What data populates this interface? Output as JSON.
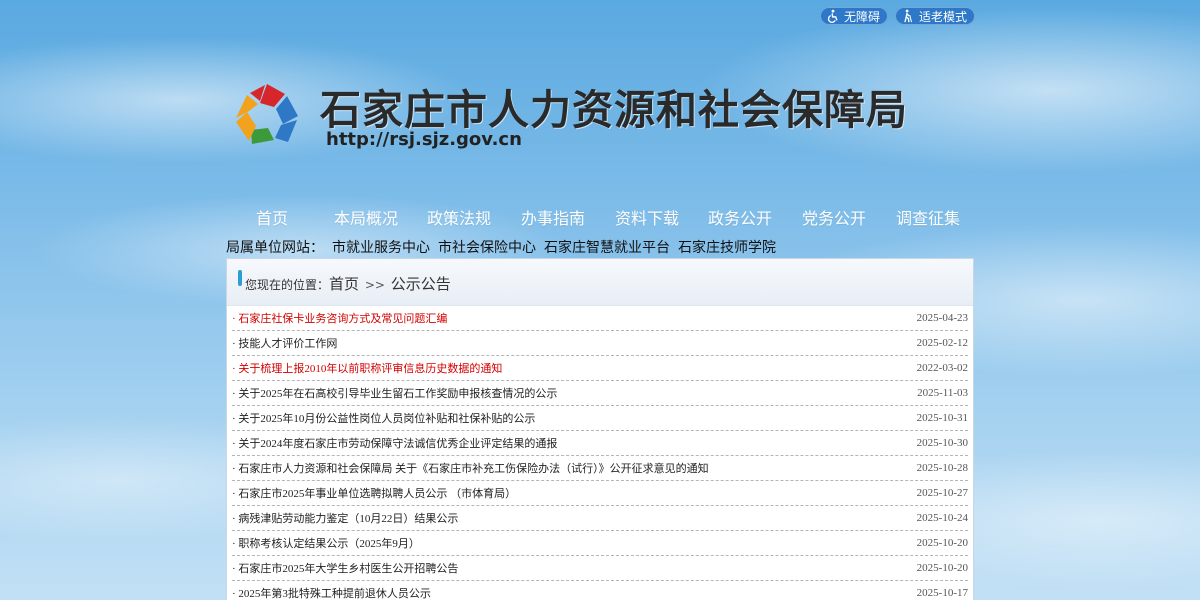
{
  "tools": {
    "accessibility_label": "无障碍",
    "elderly_label": "适老模式"
  },
  "header": {
    "title": "石家庄市人力资源和社会保障局",
    "url": "http://rsj.sjz.gov.cn"
  },
  "nav": {
    "items": [
      "首页",
      "本局概况",
      "政策法规",
      "办事指南",
      "资料下载",
      "政务公开",
      "党务公开",
      "调查征集"
    ]
  },
  "units": {
    "label": "局属单位网站：",
    "links": [
      "市就业服务中心",
      "市社会保险中心",
      "石家庄智慧就业平台",
      "石家庄技师学院"
    ]
  },
  "breadcrumb": {
    "prefix": "您现在的位置：",
    "home": "首页",
    "sep": ">>",
    "current": "公示公告"
  },
  "colors": {
    "hot_item": "#d40000",
    "tool_button": "#2d78c8",
    "head_accent": "#2a9fd6"
  },
  "list": [
    {
      "title": "石家庄社保卡业务咨询方式及常见问题汇编",
      "date": "2025-04-23",
      "hot": true
    },
    {
      "title": "技能人才评价工作网",
      "date": "2025-02-12",
      "hot": false
    },
    {
      "title": "关于梳理上报2010年以前职称评审信息历史数据的通知",
      "date": "2022-03-02",
      "hot": true
    },
    {
      "title": "关于2025年在石高校引导毕业生留石工作奖励申报核查情况的公示",
      "date": "2025-11-03",
      "hot": false
    },
    {
      "title": "关于2025年10月份公益性岗位人员岗位补贴和社保补贴的公示",
      "date": "2025-10-31",
      "hot": false
    },
    {
      "title": "关于2024年度石家庄市劳动保障守法诚信优秀企业评定结果的通报",
      "date": "2025-10-30",
      "hot": false
    },
    {
      "title": "石家庄市人力资源和社会保障局 关于《石家庄市补充工伤保险办法（试行）》公开征求意见的通知",
      "date": "2025-10-28",
      "hot": false
    },
    {
      "title": "石家庄市2025年事业单位选聘拟聘人员公示 （市体育局）",
      "date": "2025-10-27",
      "hot": false
    },
    {
      "title": "病残津贴劳动能力鉴定（10月22日）结果公示",
      "date": "2025-10-24",
      "hot": false
    },
    {
      "title": "职称考核认定结果公示（2025年9月）",
      "date": "2025-10-20",
      "hot": false
    },
    {
      "title": "石家庄市2025年大学生乡村医生公开招聘公告",
      "date": "2025-10-20",
      "hot": false
    },
    {
      "title": "2025年第3批特殊工种提前退休人员公示",
      "date": "2025-10-17",
      "hot": false
    }
  ]
}
